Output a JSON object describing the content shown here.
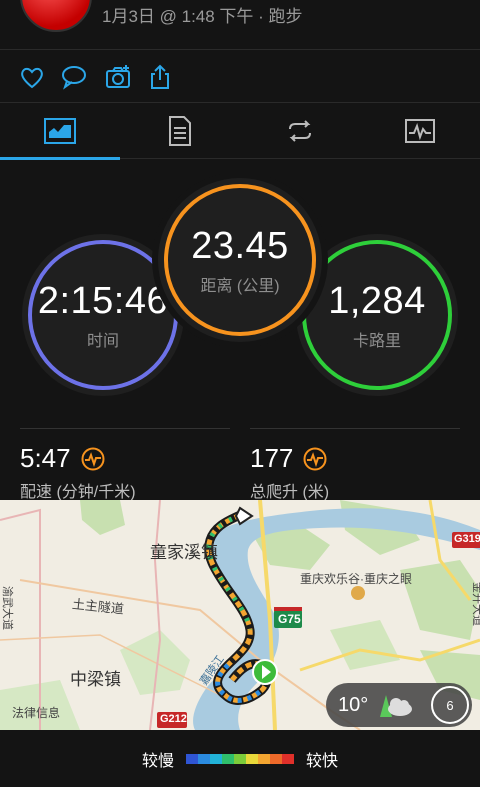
{
  "header": {
    "meta": "1月3日 @ 1:48 下午 · 跑步"
  },
  "actions": {
    "items": [
      "heart-icon",
      "comment-icon",
      "camera-icon",
      "share-icon"
    ]
  },
  "tabs": {
    "items": [
      "overview-chart-icon",
      "details-list-icon",
      "laps-loop-icon",
      "graphs-icon"
    ],
    "active": 0
  },
  "stats": {
    "distance": {
      "value": "23.45",
      "label": "距离 (公里)",
      "color": "#f7931e"
    },
    "time": {
      "value": "2:15:46",
      "label": "时间",
      "color": "#7a7cf0"
    },
    "calories": {
      "value": "1,284",
      "label": "卡路里",
      "color": "#2ecf3a"
    },
    "pace": {
      "value": "5:47",
      "label": "配速 (分钟/千米)"
    },
    "climb": {
      "value": "177",
      "label": "总爬升 (米)"
    }
  },
  "map": {
    "labels": {
      "tongjiaxi": "童家溪镇",
      "tuzhu": "土主隧道",
      "zhongliang": "中梁镇",
      "falv": "法律信息",
      "happy_valley": "重庆欢乐谷·重庆之眼",
      "jialing": "嘉陵江",
      "g75": "G75",
      "g212": "G212",
      "g319": "G319",
      "left_road": "渝武大道",
      "right_road": "金开大道"
    }
  },
  "weather": {
    "temp": "10°",
    "wind": "6"
  },
  "legend": {
    "slow": "较慢",
    "fast": "较快",
    "colors": [
      "#2f55d4",
      "#2b8be0",
      "#22b3d8",
      "#2fbf6c",
      "#7ccc3a",
      "#e8d83a",
      "#f3a531",
      "#ee6a2a",
      "#e0302a"
    ]
  }
}
